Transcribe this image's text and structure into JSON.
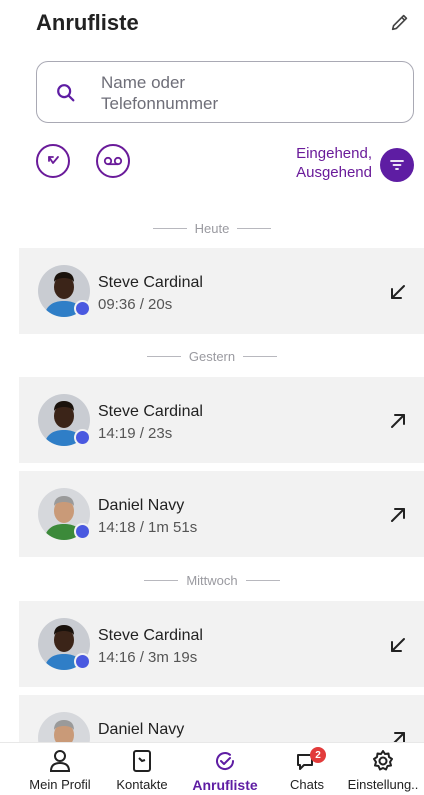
{
  "header": {
    "title": "Anrufliste",
    "edit_icon": "pencil-icon"
  },
  "search": {
    "placeholder": "Name oder Telefonnummer",
    "icon": "search-icon"
  },
  "filters": {
    "label_line1": "Eingehend,",
    "label_line2": "Ausgehend",
    "missed_icon": "missed-call-icon",
    "voicemail_icon": "voicemail-icon",
    "filter_icon": "filter-icon"
  },
  "sections": [
    {
      "label": "Heute"
    },
    {
      "label": "Gestern"
    },
    {
      "label": "Mittwoch"
    }
  ],
  "calls": [
    {
      "name": "Steve Cardinal",
      "meta": "09:36 / 20s",
      "direction": "incoming"
    },
    {
      "name": "Steve Cardinal",
      "meta": "14:19 / 23s",
      "direction": "outgoing"
    },
    {
      "name": "Daniel Navy",
      "meta": "14:18 / 1m 51s",
      "direction": "outgoing"
    },
    {
      "name": "Steve Cardinal",
      "meta": "14:16 / 3m 19s",
      "direction": "incoming"
    },
    {
      "name": "Daniel Navy",
      "meta": "",
      "direction": "outgoing"
    }
  ],
  "nav": [
    {
      "label": "Mein Profil",
      "icon": "person-icon"
    },
    {
      "label": "Kontakte",
      "icon": "contacts-icon"
    },
    {
      "label": "Anrufliste",
      "icon": "call-history-icon",
      "active": true
    },
    {
      "label": "Chats",
      "icon": "chat-icon",
      "badge": "2"
    },
    {
      "label": "Einstellung..",
      "icon": "gear-icon"
    }
  ],
  "colors": {
    "accent": "#5e1da3",
    "presence": "#4a59e0",
    "row_bg": "#f2f2f2",
    "badge": "#e23b3b"
  }
}
